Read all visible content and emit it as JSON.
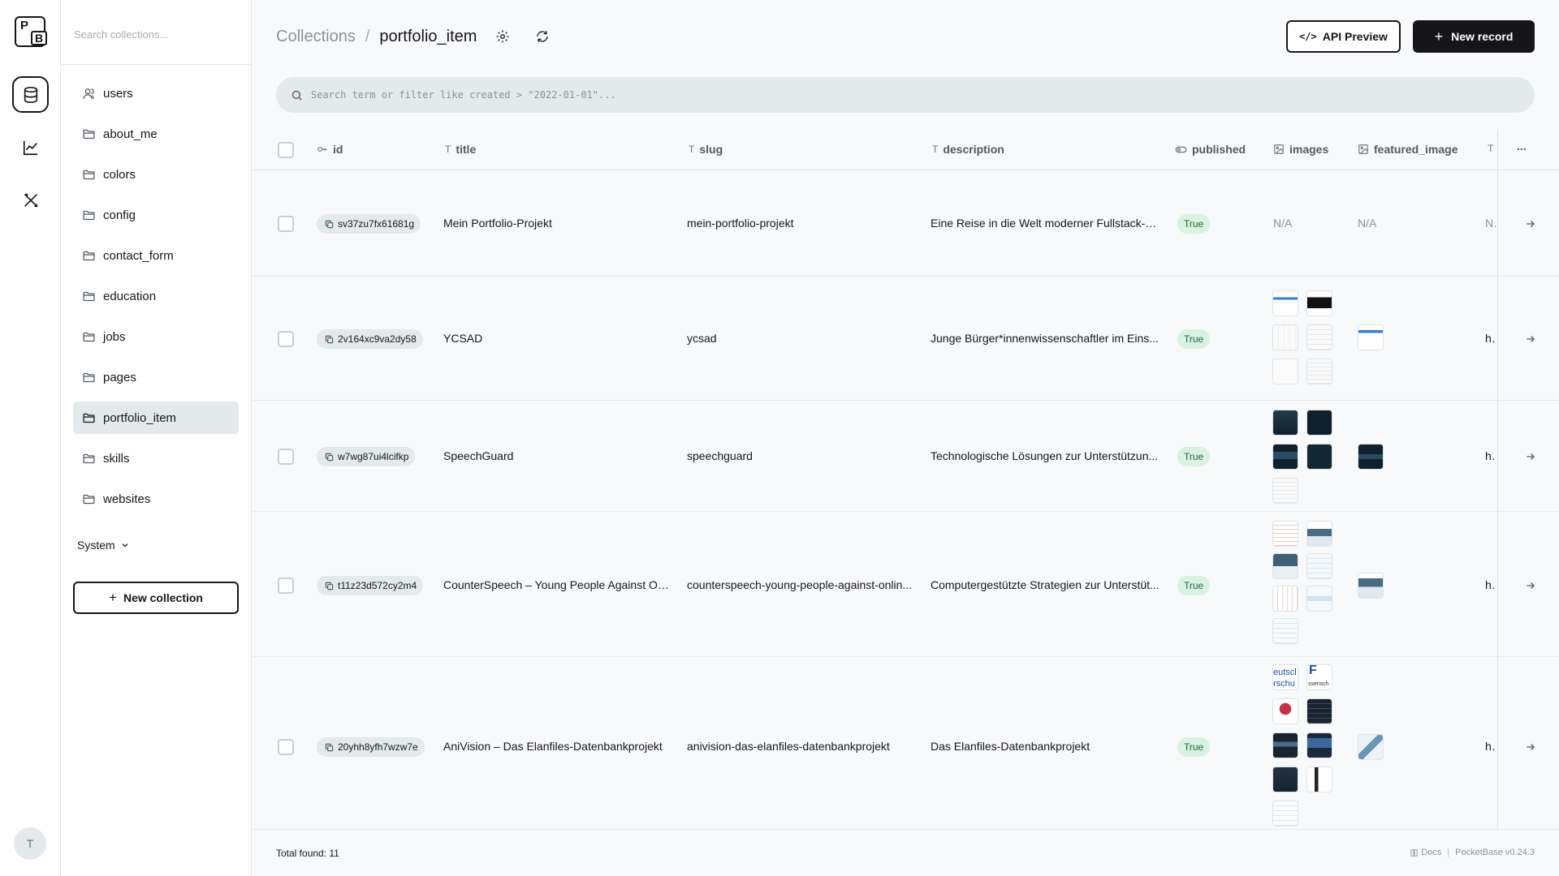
{
  "app": {
    "logo_p": "P",
    "logo_b": "B",
    "avatar_initial": "T"
  },
  "sidebar": {
    "search_placeholder": "Search collections...",
    "items": [
      {
        "label": "users",
        "icon": "user-icon"
      },
      {
        "label": "about_me",
        "icon": "folder-icon"
      },
      {
        "label": "colors",
        "icon": "folder-icon"
      },
      {
        "label": "config",
        "icon": "folder-icon"
      },
      {
        "label": "contact_form",
        "icon": "folder-icon"
      },
      {
        "label": "education",
        "icon": "folder-icon"
      },
      {
        "label": "jobs",
        "icon": "folder-icon"
      },
      {
        "label": "pages",
        "icon": "folder-icon"
      },
      {
        "label": "portfolio_item",
        "icon": "folder-icon",
        "active": true
      },
      {
        "label": "skills",
        "icon": "folder-icon"
      },
      {
        "label": "websites",
        "icon": "folder-icon"
      }
    ],
    "system_label": "System",
    "new_collection_label": "New collection"
  },
  "header": {
    "crumb_root": "Collections",
    "crumb_separator": "/",
    "crumb_current": "portfolio_item",
    "api_preview_label": "API Preview",
    "new_record_label": "New record"
  },
  "filter": {
    "placeholder": "Search term or filter like created > \"2022-01-01\"..."
  },
  "table": {
    "columns": {
      "id": "id",
      "title": "title",
      "slug": "slug",
      "description": "description",
      "published": "published",
      "images": "images",
      "featured_image": "featured_image",
      "more": "..."
    },
    "rows": [
      {
        "id": "sv37zu7fx61681g",
        "title": "Mein Portfolio-Projekt",
        "slug": "mein-portfolio-projekt",
        "description": "Eine Reise in die Welt moderner Fullstack-E...",
        "published": "True",
        "images": "N/A",
        "featured_image": "N/A",
        "url": "N/A"
      },
      {
        "id": "2v164xc9va2dy58",
        "title": "YCSAD",
        "slug": "ycsad",
        "description": "Junge Bürger*innenwissenschaftler im Eins...",
        "published": "True",
        "images": "",
        "featured_image": "",
        "url": "htt"
      },
      {
        "id": "w7wg87ui4lcifkp",
        "title": "SpeechGuard",
        "slug": "speechguard",
        "description": "Technologische Lösungen zur Unterstützun...",
        "published": "True",
        "images": "",
        "featured_image": "",
        "url": "htt"
      },
      {
        "id": "t11z23d572cy2m4",
        "title": "CounterSpeech – Young People Against Onli...",
        "slug": "counterspeech-young-people-against-onlin...",
        "description": "Computergestützte Strategien zur Unterstüt...",
        "published": "True",
        "images": "",
        "featured_image": "",
        "url": "htt"
      },
      {
        "id": "20yhh8yfh7wzw7e",
        "title": "AniVision – Das Elanfiles-Datenbankprojekt",
        "slug": "anivision-das-elanfiles-datenbankprojekt",
        "description": "Das Elanfiles-Datenbankprojekt",
        "published": "True",
        "images": "",
        "featured_image": "",
        "url": "htt"
      }
    ],
    "thumb_text_1": "eutscl\nrschu",
    "thumb_text_2": "F",
    "thumb_text_3": "ssensch"
  },
  "footer": {
    "total_label": "Total found:",
    "total_value": "11",
    "docs_label": "Docs",
    "separator": "|",
    "version": "PocketBase v0.24.3"
  },
  "colors": {
    "accent": "#16161a",
    "badge_success_bg": "#d9f2e1",
    "badge_success_text": "#1e6b3a",
    "muted": "#e4e9ec"
  }
}
